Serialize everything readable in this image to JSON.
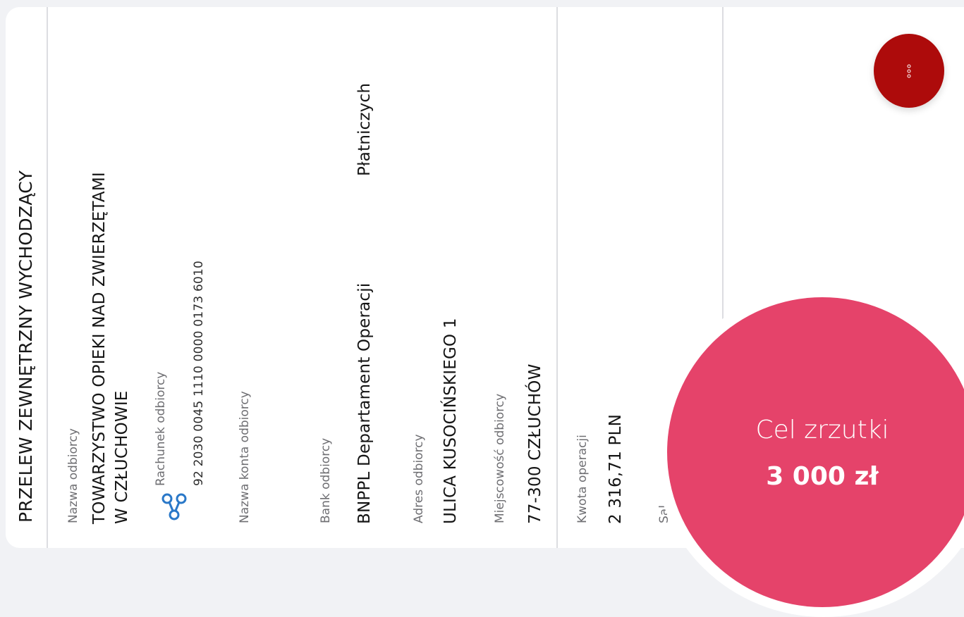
{
  "transfer": {
    "title": "PRZELEW ZEWNĘTRZNY WYCHODZĄCY",
    "recipient_name_label": "Nazwa odbiorcy",
    "recipient_name_line1": "TOWARZYSTWO OPIEKI NAD ZWIERZĘTAMI",
    "recipient_name_line2": "W CZŁUCHOWIE",
    "account_label": "Rachunek odbiorcy",
    "account_number": "92 2030 0045 1110 0000 0173 6010",
    "account_name_label": "Nazwa konta odbiorcy",
    "bank_label": "Bank odbiorcy",
    "bank_name": "BNPPL Departament Operacji",
    "bank_name_cont": "Płatniczych",
    "address_label": "Adres odbiorcy",
    "address": "ULICA KUSOCIŃSKIEGO 1",
    "city_label": "Miejscowość odbiorcy",
    "city": "77-300 CZŁUCHÓW",
    "amount_label": "Kwota operacji",
    "amount": "2 316,71 PLN",
    "balance_label_partial": "Sal"
  },
  "icons": {
    "account": "account-link-icon",
    "more": "more-options-icon"
  },
  "goal": {
    "label": "Cel zrzutki",
    "value": "3 000 zł"
  },
  "colors": {
    "accent": "#ad0b0b",
    "goal": "#e5436a"
  }
}
